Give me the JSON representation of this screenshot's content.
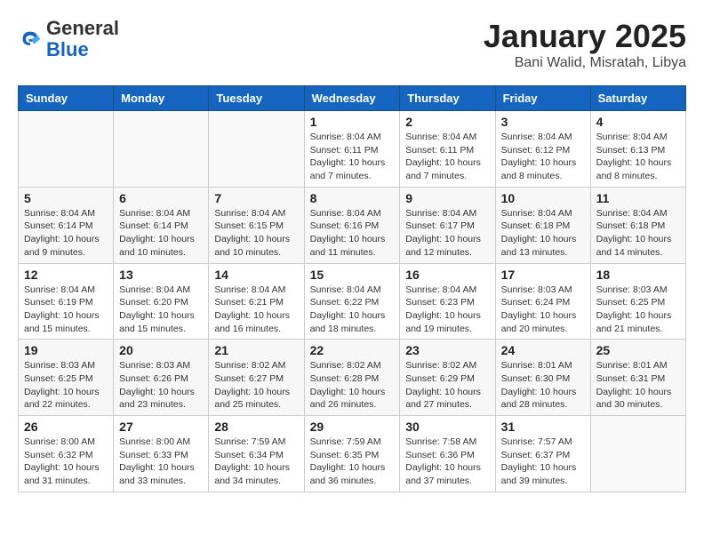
{
  "header": {
    "logo_line1": "General",
    "logo_line2": "Blue",
    "month_title": "January 2025",
    "location": "Bani Walid, Misratah, Libya"
  },
  "days_of_week": [
    "Sunday",
    "Monday",
    "Tuesday",
    "Wednesday",
    "Thursday",
    "Friday",
    "Saturday"
  ],
  "weeks": [
    {
      "row_class": "row-odd",
      "days": [
        {
          "number": "",
          "info": "",
          "empty": true
        },
        {
          "number": "",
          "info": "",
          "empty": true
        },
        {
          "number": "",
          "info": "",
          "empty": true
        },
        {
          "number": "1",
          "info": "Sunrise: 8:04 AM\nSunset: 6:11 PM\nDaylight: 10 hours\nand 7 minutes.",
          "empty": false
        },
        {
          "number": "2",
          "info": "Sunrise: 8:04 AM\nSunset: 6:11 PM\nDaylight: 10 hours\nand 7 minutes.",
          "empty": false
        },
        {
          "number": "3",
          "info": "Sunrise: 8:04 AM\nSunset: 6:12 PM\nDaylight: 10 hours\nand 8 minutes.",
          "empty": false
        },
        {
          "number": "4",
          "info": "Sunrise: 8:04 AM\nSunset: 6:13 PM\nDaylight: 10 hours\nand 8 minutes.",
          "empty": false
        }
      ]
    },
    {
      "row_class": "row-even",
      "days": [
        {
          "number": "5",
          "info": "Sunrise: 8:04 AM\nSunset: 6:14 PM\nDaylight: 10 hours\nand 9 minutes.",
          "empty": false
        },
        {
          "number": "6",
          "info": "Sunrise: 8:04 AM\nSunset: 6:14 PM\nDaylight: 10 hours\nand 10 minutes.",
          "empty": false
        },
        {
          "number": "7",
          "info": "Sunrise: 8:04 AM\nSunset: 6:15 PM\nDaylight: 10 hours\nand 10 minutes.",
          "empty": false
        },
        {
          "number": "8",
          "info": "Sunrise: 8:04 AM\nSunset: 6:16 PM\nDaylight: 10 hours\nand 11 minutes.",
          "empty": false
        },
        {
          "number": "9",
          "info": "Sunrise: 8:04 AM\nSunset: 6:17 PM\nDaylight: 10 hours\nand 12 minutes.",
          "empty": false
        },
        {
          "number": "10",
          "info": "Sunrise: 8:04 AM\nSunset: 6:18 PM\nDaylight: 10 hours\nand 13 minutes.",
          "empty": false
        },
        {
          "number": "11",
          "info": "Sunrise: 8:04 AM\nSunset: 6:18 PM\nDaylight: 10 hours\nand 14 minutes.",
          "empty": false
        }
      ]
    },
    {
      "row_class": "row-odd",
      "days": [
        {
          "number": "12",
          "info": "Sunrise: 8:04 AM\nSunset: 6:19 PM\nDaylight: 10 hours\nand 15 minutes.",
          "empty": false
        },
        {
          "number": "13",
          "info": "Sunrise: 8:04 AM\nSunset: 6:20 PM\nDaylight: 10 hours\nand 15 minutes.",
          "empty": false
        },
        {
          "number": "14",
          "info": "Sunrise: 8:04 AM\nSunset: 6:21 PM\nDaylight: 10 hours\nand 16 minutes.",
          "empty": false
        },
        {
          "number": "15",
          "info": "Sunrise: 8:04 AM\nSunset: 6:22 PM\nDaylight: 10 hours\nand 18 minutes.",
          "empty": false
        },
        {
          "number": "16",
          "info": "Sunrise: 8:04 AM\nSunset: 6:23 PM\nDaylight: 10 hours\nand 19 minutes.",
          "empty": false
        },
        {
          "number": "17",
          "info": "Sunrise: 8:03 AM\nSunset: 6:24 PM\nDaylight: 10 hours\nand 20 minutes.",
          "empty": false
        },
        {
          "number": "18",
          "info": "Sunrise: 8:03 AM\nSunset: 6:25 PM\nDaylight: 10 hours\nand 21 minutes.",
          "empty": false
        }
      ]
    },
    {
      "row_class": "row-even",
      "days": [
        {
          "number": "19",
          "info": "Sunrise: 8:03 AM\nSunset: 6:25 PM\nDaylight: 10 hours\nand 22 minutes.",
          "empty": false
        },
        {
          "number": "20",
          "info": "Sunrise: 8:03 AM\nSunset: 6:26 PM\nDaylight: 10 hours\nand 23 minutes.",
          "empty": false
        },
        {
          "number": "21",
          "info": "Sunrise: 8:02 AM\nSunset: 6:27 PM\nDaylight: 10 hours\nand 25 minutes.",
          "empty": false
        },
        {
          "number": "22",
          "info": "Sunrise: 8:02 AM\nSunset: 6:28 PM\nDaylight: 10 hours\nand 26 minutes.",
          "empty": false
        },
        {
          "number": "23",
          "info": "Sunrise: 8:02 AM\nSunset: 6:29 PM\nDaylight: 10 hours\nand 27 minutes.",
          "empty": false
        },
        {
          "number": "24",
          "info": "Sunrise: 8:01 AM\nSunset: 6:30 PM\nDaylight: 10 hours\nand 28 minutes.",
          "empty": false
        },
        {
          "number": "25",
          "info": "Sunrise: 8:01 AM\nSunset: 6:31 PM\nDaylight: 10 hours\nand 30 minutes.",
          "empty": false
        }
      ]
    },
    {
      "row_class": "row-odd",
      "days": [
        {
          "number": "26",
          "info": "Sunrise: 8:00 AM\nSunset: 6:32 PM\nDaylight: 10 hours\nand 31 minutes.",
          "empty": false
        },
        {
          "number": "27",
          "info": "Sunrise: 8:00 AM\nSunset: 6:33 PM\nDaylight: 10 hours\nand 33 minutes.",
          "empty": false
        },
        {
          "number": "28",
          "info": "Sunrise: 7:59 AM\nSunset: 6:34 PM\nDaylight: 10 hours\nand 34 minutes.",
          "empty": false
        },
        {
          "number": "29",
          "info": "Sunrise: 7:59 AM\nSunset: 6:35 PM\nDaylight: 10 hours\nand 36 minutes.",
          "empty": false
        },
        {
          "number": "30",
          "info": "Sunrise: 7:58 AM\nSunset: 6:36 PM\nDaylight: 10 hours\nand 37 minutes.",
          "empty": false
        },
        {
          "number": "31",
          "info": "Sunrise: 7:57 AM\nSunset: 6:37 PM\nDaylight: 10 hours\nand 39 minutes.",
          "empty": false
        },
        {
          "number": "",
          "info": "",
          "empty": true
        }
      ]
    }
  ]
}
